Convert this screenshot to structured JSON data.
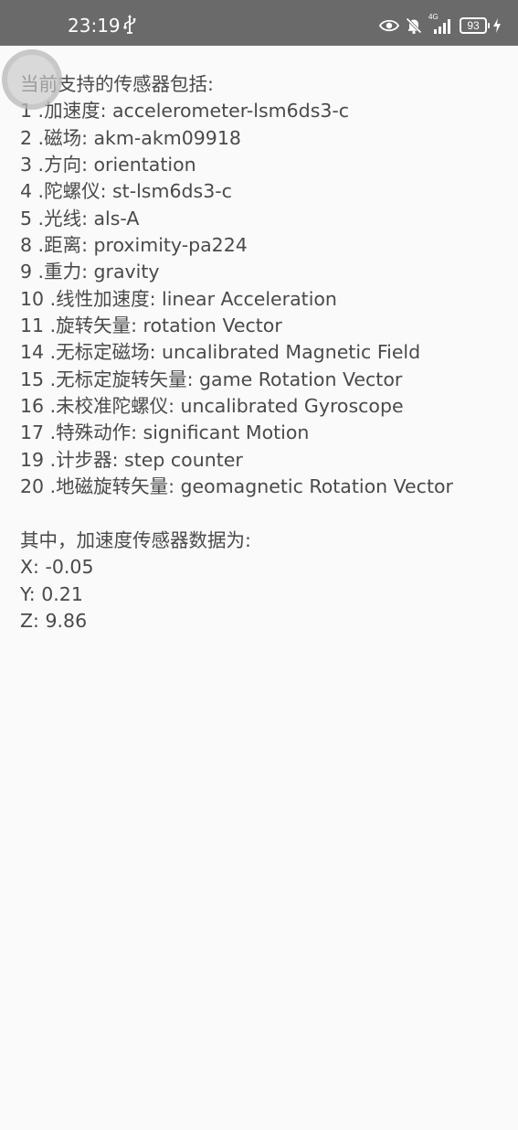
{
  "status_bar": {
    "time": "23:19",
    "network": "4G",
    "battery_level": "93",
    "icons": [
      "usb-icon",
      "eye-icon",
      "bell-off-icon",
      "signal-icon",
      "battery-icon",
      "charging-bolt-icon"
    ]
  },
  "floating_button": {
    "icon": "assistive-touch-icon"
  },
  "sensors": {
    "header": "当前支持的传感器包括:",
    "items": [
      "1 .加速度: accelerometer-lsm6ds3-c",
      "2 .磁场: akm-akm09918",
      "3 .方向: orientation",
      "4 .陀螺仪: st-lsm6ds3-c",
      "5 .光线: als-A",
      "8 .距离: proximity-pa224",
      "9 .重力: gravity",
      "10 .线性加速度: linear Acceleration",
      "11 .旋转矢量: rotation Vector",
      "14 .无标定磁场: uncalibrated Magnetic Field",
      "15 .无标定旋转矢量: game Rotation Vector",
      "16 .未校准陀螺仪: uncalibrated Gyroscope",
      "17 .特殊动作: significant Motion",
      "19 .计步器: step counter",
      "20 .地磁旋转矢量: geomagnetic Rotation Vector"
    ]
  },
  "accelerometer": {
    "header": "其中，加速度传感器数据为:",
    "x": "X: -0.05",
    "y": "Y: 0.21",
    "z": "Z: 9.86"
  },
  "colors": {
    "status_bar_bg": "#6a6a6a",
    "page_bg": "#fafafa",
    "text": "#4a4a4a"
  }
}
